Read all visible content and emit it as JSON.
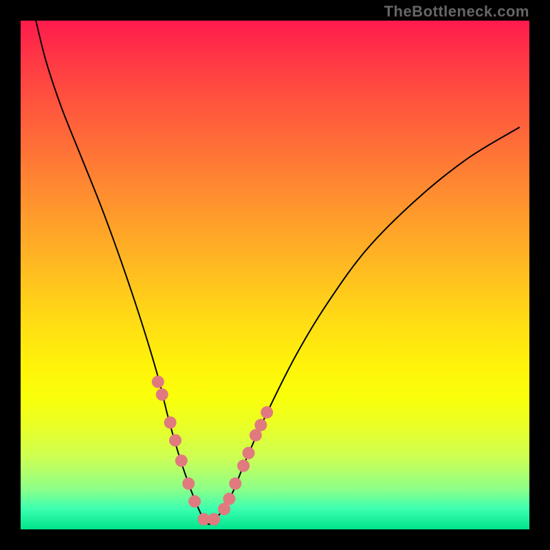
{
  "watermark": "TheBottleneck.com",
  "chart_data": {
    "type": "line",
    "title": "",
    "xlabel": "",
    "ylabel": "",
    "xlim": [
      0,
      100
    ],
    "ylim": [
      0,
      100
    ],
    "series": [
      {
        "name": "bottleneck-curve",
        "x": [
          3,
          5,
          8,
          12,
          16,
          20,
          24,
          27,
          29,
          31,
          33,
          35,
          36,
          37,
          38,
          40,
          42,
          44,
          48,
          54,
          60,
          68,
          78,
          88,
          98
        ],
        "y": [
          100,
          92,
          83,
          73,
          63,
          52,
          40,
          30,
          22,
          15,
          9,
          4,
          2,
          1,
          2,
          4,
          8,
          13,
          22,
          34,
          44,
          55,
          65,
          73,
          79
        ]
      }
    ],
    "markers": {
      "name": "highlight-dots",
      "color": "#e07a7f",
      "x": [
        27.0,
        27.8,
        29.4,
        30.4,
        31.6,
        33.0,
        34.2,
        36.0,
        38.0,
        40.0,
        41.0,
        42.2,
        43.8,
        44.8,
        46.2,
        47.2,
        48.4
      ],
      "y": [
        29.0,
        26.5,
        21.0,
        17.5,
        13.5,
        9.0,
        5.5,
        2.0,
        2.0,
        4.0,
        6.0,
        9.0,
        12.5,
        15.0,
        18.5,
        20.5,
        23.0
      ]
    },
    "gradient_stops": [
      {
        "pos": 0.0,
        "color": "#ff1a4d"
      },
      {
        "pos": 0.5,
        "color": "#ffd916"
      },
      {
        "pos": 0.75,
        "color": "#faff0a"
      },
      {
        "pos": 1.0,
        "color": "#00e38c"
      }
    ]
  }
}
